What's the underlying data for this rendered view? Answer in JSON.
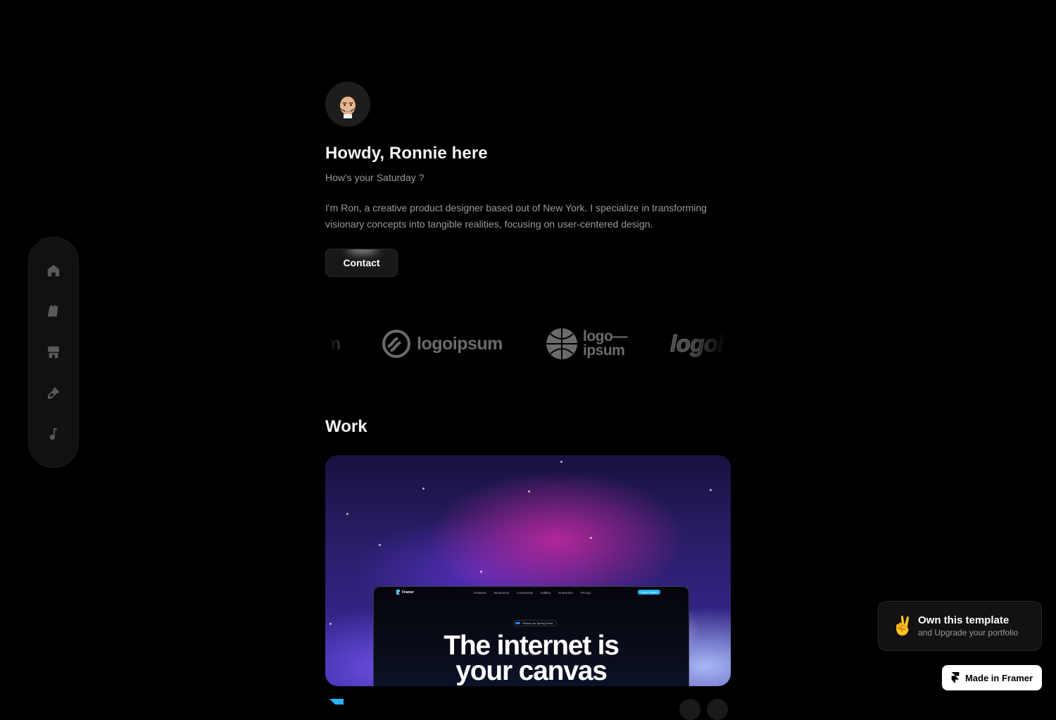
{
  "sidebar": {
    "items": [
      {
        "icon": "home-icon"
      },
      {
        "icon": "notebook-icon"
      },
      {
        "icon": "store-icon"
      },
      {
        "icon": "pen-icon"
      },
      {
        "icon": "music-note-icon"
      }
    ]
  },
  "profile": {
    "greeting": "Howdy, Ronnie here",
    "subgreeting": "How's your Saturday ?",
    "bio": "I'm Ron, a creative product designer based out of New York. I specialize in transforming visionary concepts into tangible realities, focusing on user-centered design.",
    "contact_label": "Contact"
  },
  "logos": {
    "partial_left": "m",
    "logo1": "logoipsum",
    "logo2_line1": "logo—",
    "logo2_line2": "ipsum",
    "logo3": "logoi"
  },
  "work": {
    "title": "Work",
    "preview": {
      "brand": "Framer",
      "nav_links": [
        "Features",
        "Resources",
        "Community",
        "Gallery",
        "Enterprise",
        "Pricing"
      ],
      "cta": "Open Framer",
      "pill": "Replay our Spring Event",
      "headline_line1": "The internet is",
      "headline_line2": "your canvas"
    }
  },
  "promo": {
    "emoji": "✌️",
    "title": "Own this template",
    "subtitle": "and Upgrade your portfolio"
  },
  "badge": {
    "label": "Made in Framer"
  },
  "colors": {
    "background": "#000000",
    "accent": "#28b3ff"
  }
}
